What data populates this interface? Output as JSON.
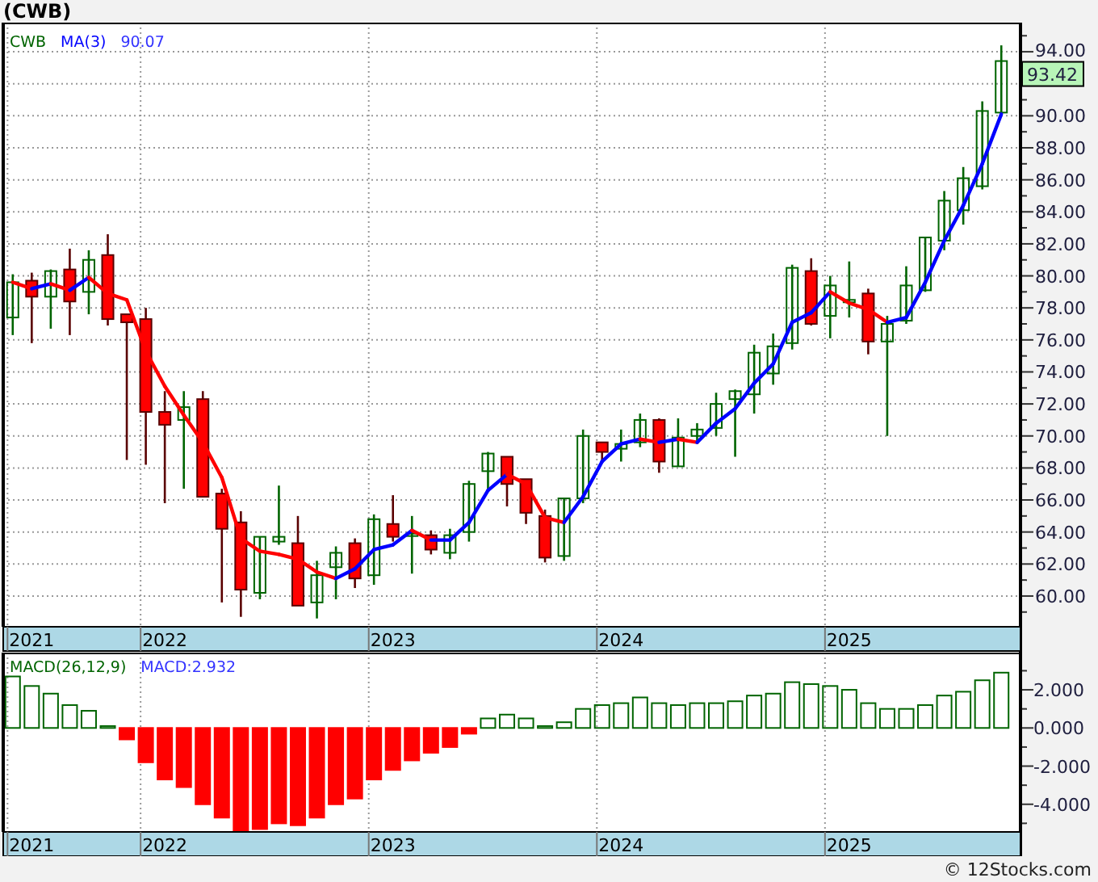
{
  "title": "(CWB)",
  "price_chart": {
    "legend": [
      {
        "text": "90.07",
        "color": "#3333ff"
      }
    ],
    "last_price": "93.42",
    "chart_data": {
      "type": "candlestick",
      "grid": true,
      "ylim": [
        58.08,
        95.82
      ],
      "categories": [
        null,
        "2021",
        null,
        null,
        null,
        null,
        null,
        null,
        "2022",
        null,
        null,
        null,
        null,
        null,
        null,
        null,
        null,
        null,
        null,
        null,
        "2023",
        null,
        null,
        null,
        null,
        null,
        null,
        null,
        null,
        null,
        null,
        null,
        "2024",
        null,
        null,
        null,
        null,
        null,
        null,
        null,
        null,
        null,
        null,
        null,
        "2025",
        null,
        null,
        null,
        null,
        null,
        null,
        null,
        null
      ],
      "yticks": [
        {
          "value": 60,
          "label": "60.00"
        },
        {
          "value": 62,
          "label": "62.00"
        },
        {
          "value": 64,
          "label": "64.00"
        },
        {
          "value": 66,
          "label": "66.00"
        },
        {
          "value": 68,
          "label": "68.00"
        },
        {
          "value": 70,
          "label": "70.00"
        },
        {
          "value": 72,
          "label": "72.00"
        },
        {
          "value": 74,
          "label": "74.00"
        },
        {
          "value": 76,
          "label": "76.00"
        },
        {
          "value": 78,
          "label": "78.00"
        },
        {
          "value": 80,
          "label": "80.00"
        },
        {
          "value": 82,
          "label": "82.00"
        },
        {
          "value": 84,
          "label": "84.00"
        },
        {
          "value": 86,
          "label": "86.00"
        },
        {
          "value": 88,
          "label": "88.00"
        },
        {
          "value": 90,
          "label": "90.00"
        },
        {
          "value": 94,
          "label": "94.00"
        }
      ],
      "series": [
        {
          "name": "CWB",
          "color": "#006400",
          "ohlc": [
            [
              77.4,
              80.1,
              76.3,
              79.6
            ],
            null,
            [
              78.7,
              80.4,
              76.7,
              80.3
            ],
            null,
            [
              79.0,
              81.6,
              77.6,
              81.0
            ],
            null,
            null,
            null,
            null,
            [
              71.0,
              72.8,
              66.7,
              71.8
            ],
            null,
            null,
            null,
            [
              60.2,
              63.7,
              59.8,
              63.7
            ],
            [
              63.4,
              66.9,
              63.2,
              63.7
            ],
            null,
            [
              59.6,
              62.2,
              58.6,
              61.3
            ],
            [
              61.8,
              63.1,
              59.8,
              62.7
            ],
            null,
            [
              61.3,
              65.1,
              60.7,
              64.8
            ],
            null,
            [
              63.8,
              65.0,
              61.4,
              63.9
            ],
            null,
            [
              62.7,
              64.2,
              62.3,
              63.8
            ],
            [
              64.0,
              67.2,
              63.4,
              67.0
            ],
            [
              67.8,
              69.0,
              66.7,
              68.9
            ],
            null,
            null,
            null,
            [
              62.5,
              66.1,
              62.2,
              66.1
            ],
            [
              66.1,
              70.4,
              65.8,
              70.0
            ],
            null,
            [
              69.2,
              70.4,
              68.4,
              69.5
            ],
            [
              69.6,
              71.4,
              69.3,
              71.0
            ],
            null,
            [
              68.1,
              71.1,
              68.1,
              69.9
            ],
            [
              70.0,
              70.8,
              69.6,
              70.4
            ],
            [
              70.5,
              72.7,
              70.0,
              72.0
            ],
            [
              72.3,
              72.9,
              68.7,
              72.8
            ],
            [
              72.6,
              75.7,
              71.4,
              75.2
            ],
            [
              73.9,
              76.4,
              73.2,
              75.6
            ],
            [
              75.8,
              80.7,
              75.4,
              80.5
            ],
            null,
            [
              77.5,
              80.0,
              76.1,
              79.4
            ],
            [
              78.4,
              80.9,
              77.4,
              78.5
            ],
            null,
            [
              75.9,
              77.5,
              70.0,
              77.0
            ],
            [
              77.2,
              80.6,
              77.0,
              79.4
            ],
            [
              79.1,
              82.4,
              79.0,
              82.4
            ],
            [
              82.2,
              85.3,
              81.6,
              84.7
            ],
            [
              84.1,
              86.8,
              83.2,
              86.1
            ],
            [
              85.6,
              90.9,
              85.4,
              90.3
            ],
            [
              90.2,
              94.4,
              90.2,
              93.42
            ]
          ]
        },
        {
          "color": "#ff0000",
          "ohlc": [
            null,
            [
              79.7,
              80.2,
              75.8,
              78.7
            ],
            null,
            [
              80.4,
              81.7,
              76.3,
              78.4
            ],
            null,
            [
              81.3,
              82.6,
              76.9,
              77.3
            ],
            [
              77.6,
              77.6,
              68.5,
              77.1
            ],
            [
              77.3,
              78.0,
              68.2,
              71.5
            ],
            [
              71.5,
              72.8,
              65.8,
              70.7
            ],
            null,
            [
              72.3,
              72.8,
              66.2,
              66.2
            ],
            [
              66.4,
              66.7,
              59.6,
              64.2
            ],
            [
              64.6,
              65.3,
              58.7,
              60.4
            ],
            null,
            null,
            [
              63.3,
              65.0,
              59.4,
              59.4
            ],
            null,
            null,
            [
              63.3,
              63.6,
              60.5,
              61.1
            ],
            null,
            [
              64.5,
              66.3,
              63.4,
              63.7
            ],
            null,
            [
              63.8,
              64.1,
              62.6,
              62.9
            ],
            null,
            null,
            null,
            [
              68.7,
              68.7,
              65.6,
              67.0
            ],
            [
              67.3,
              67.3,
              64.5,
              65.2
            ],
            [
              65.0,
              65.4,
              62.1,
              62.4
            ],
            null,
            null,
            [
              69.6,
              69.6,
              68.4,
              69.0
            ],
            null,
            null,
            [
              71.0,
              71.1,
              67.7,
              68.4
            ],
            null,
            null,
            null,
            null,
            null,
            null,
            null,
            [
              80.3,
              81.1,
              76.9,
              77.0
            ],
            null,
            null,
            [
              78.9,
              79.2,
              75.1,
              75.9
            ],
            null,
            null,
            null,
            null,
            null,
            null,
            null
          ]
        },
        {
          "type": "line",
          "color": "#ff0000",
          "values": [
            79.6,
            79.2,
            null,
            null,
            null,
            null,
            null,
            null,
            null,
            null,
            null,
            null,
            null,
            null,
            null,
            null,
            null,
            null,
            null,
            null,
            null,
            null,
            null,
            null,
            null,
            null,
            null,
            null,
            null,
            null,
            null,
            null,
            null,
            null,
            null,
            null,
            null,
            null,
            null,
            null,
            null,
            null,
            null,
            null,
            null,
            null,
            null,
            null,
            null,
            null,
            null,
            null,
            null
          ]
        },
        {
          "name": "MA(3)",
          "type": "line",
          "color": "#0000ff",
          "values": [
            null,
            79.2,
            79.5,
            null,
            null,
            null,
            null,
            null,
            null,
            null,
            null,
            null,
            null,
            null,
            null,
            null,
            null,
            null,
            null,
            null,
            null,
            null,
            null,
            null,
            null,
            null,
            null,
            null,
            null,
            null,
            null,
            null,
            null,
            null,
            null,
            null,
            null,
            null,
            null,
            null,
            null,
            null,
            null,
            null,
            null,
            null,
            null,
            null,
            null,
            null,
            null,
            null,
            null
          ]
        },
        {
          "type": "line",
          "color": "#ff0000",
          "values": [
            null,
            null,
            79.5,
            79.1,
            null,
            null,
            null,
            null,
            null,
            null,
            null,
            null,
            null,
            null,
            null,
            null,
            null,
            null,
            null,
            null,
            null,
            null,
            null,
            null,
            null,
            null,
            null,
            null,
            null,
            null,
            null,
            null,
            null,
            null,
            null,
            null,
            null,
            null,
            null,
            null,
            null,
            null,
            null,
            null,
            null,
            null,
            null,
            null,
            null,
            null,
            null,
            null,
            null
          ]
        },
        {
          "type": "line",
          "color": "#0000ff",
          "values": [
            null,
            null,
            null,
            79.1,
            79.9,
            null,
            null,
            null,
            null,
            null,
            null,
            null,
            null,
            null,
            null,
            null,
            null,
            null,
            null,
            null,
            null,
            null,
            null,
            null,
            null,
            null,
            null,
            null,
            null,
            null,
            null,
            null,
            null,
            null,
            null,
            null,
            null,
            null,
            null,
            null,
            null,
            null,
            null,
            null,
            null,
            null,
            null,
            null,
            null,
            null,
            null,
            null,
            null
          ]
        },
        {
          "type": "line",
          "color": "#ff0000",
          "values": [
            null,
            null,
            null,
            null,
            79.9,
            78.9,
            78.5,
            75.3,
            73.1,
            71.3,
            69.6,
            67.4,
            63.6,
            62.8,
            62.6,
            62.3,
            61.5,
            61.1,
            null,
            null,
            null,
            null,
            null,
            null,
            null,
            null,
            null,
            null,
            null,
            null,
            null,
            null,
            null,
            null,
            null,
            null,
            null,
            null,
            null,
            null,
            null,
            null,
            null,
            null,
            null,
            null,
            null,
            null,
            null,
            null,
            null,
            null,
            null
          ]
        },
        {
          "type": "line",
          "color": "#0000ff",
          "values": [
            null,
            null,
            null,
            null,
            null,
            null,
            null,
            null,
            null,
            null,
            null,
            null,
            null,
            null,
            null,
            null,
            null,
            61.1,
            61.7,
            62.9,
            63.2,
            64.1,
            null,
            null,
            null,
            null,
            null,
            null,
            null,
            null,
            null,
            null,
            null,
            null,
            null,
            null,
            null,
            null,
            null,
            null,
            null,
            null,
            null,
            null,
            null,
            null,
            null,
            null,
            null,
            null,
            null,
            null,
            null
          ]
        },
        {
          "type": "line",
          "color": "#ff0000",
          "values": [
            null,
            null,
            null,
            null,
            null,
            null,
            null,
            null,
            null,
            null,
            null,
            null,
            null,
            null,
            null,
            null,
            null,
            null,
            null,
            null,
            null,
            64.1,
            63.5,
            null,
            null,
            null,
            null,
            null,
            null,
            null,
            null,
            null,
            null,
            null,
            null,
            null,
            null,
            null,
            null,
            null,
            null,
            null,
            null,
            null,
            null,
            null,
            null,
            null,
            null,
            null,
            null,
            null,
            null
          ]
        },
        {
          "type": "line",
          "color": "#0000ff",
          "values": [
            null,
            null,
            null,
            null,
            null,
            null,
            null,
            null,
            null,
            null,
            null,
            null,
            null,
            null,
            null,
            null,
            null,
            null,
            null,
            null,
            null,
            null,
            63.5,
            63.5,
            64.6,
            66.6,
            67.6,
            null,
            null,
            null,
            null,
            null,
            null,
            null,
            null,
            null,
            null,
            null,
            null,
            null,
            null,
            null,
            null,
            null,
            null,
            null,
            null,
            null,
            null,
            null,
            null,
            null,
            null
          ]
        },
        {
          "type": "line",
          "color": "#ff0000",
          "values": [
            null,
            null,
            null,
            null,
            null,
            null,
            null,
            null,
            null,
            null,
            null,
            null,
            null,
            null,
            null,
            null,
            null,
            null,
            null,
            null,
            null,
            null,
            null,
            null,
            null,
            null,
            67.6,
            67.0,
            64.9,
            64.6,
            null,
            null,
            null,
            null,
            null,
            null,
            null,
            null,
            null,
            null,
            null,
            null,
            null,
            null,
            null,
            null,
            null,
            null,
            null,
            null,
            null,
            null,
            null
          ]
        },
        {
          "type": "line",
          "color": "#0000ff",
          "values": [
            null,
            null,
            null,
            null,
            null,
            null,
            null,
            null,
            null,
            null,
            null,
            null,
            null,
            null,
            null,
            null,
            null,
            null,
            null,
            null,
            null,
            null,
            null,
            null,
            null,
            null,
            null,
            null,
            null,
            64.6,
            66.2,
            68.4,
            69.5,
            69.8,
            null,
            null,
            null,
            null,
            null,
            null,
            null,
            null,
            null,
            null,
            null,
            null,
            null,
            null,
            null,
            null,
            null,
            null,
            null
          ]
        },
        {
          "type": "line",
          "color": "#ff0000",
          "values": [
            null,
            null,
            null,
            null,
            null,
            null,
            null,
            null,
            null,
            null,
            null,
            null,
            null,
            null,
            null,
            null,
            null,
            null,
            null,
            null,
            null,
            null,
            null,
            null,
            null,
            null,
            null,
            null,
            null,
            null,
            null,
            null,
            null,
            69.8,
            69.6,
            null,
            null,
            null,
            null,
            null,
            null,
            null,
            null,
            null,
            null,
            null,
            null,
            null,
            null,
            null,
            null,
            null,
            null
          ]
        },
        {
          "type": "line",
          "color": "#0000ff",
          "values": [
            null,
            null,
            null,
            null,
            null,
            null,
            null,
            null,
            null,
            null,
            null,
            null,
            null,
            null,
            null,
            null,
            null,
            null,
            null,
            null,
            null,
            null,
            null,
            null,
            null,
            null,
            null,
            null,
            null,
            null,
            null,
            null,
            null,
            null,
            69.6,
            69.8,
            null,
            null,
            null,
            null,
            null,
            null,
            null,
            null,
            null,
            null,
            null,
            null,
            null,
            null,
            null,
            null,
            null
          ]
        },
        {
          "type": "line",
          "color": "#ff0000",
          "values": [
            null,
            null,
            null,
            null,
            null,
            null,
            null,
            null,
            null,
            null,
            null,
            null,
            null,
            null,
            null,
            null,
            null,
            null,
            null,
            null,
            null,
            null,
            null,
            null,
            null,
            null,
            null,
            null,
            null,
            null,
            null,
            null,
            null,
            null,
            null,
            69.8,
            69.6,
            null,
            null,
            null,
            null,
            null,
            null,
            null,
            null,
            null,
            null,
            null,
            null,
            null,
            null,
            null,
            null
          ]
        },
        {
          "type": "line",
          "color": "#0000ff",
          "values": [
            null,
            null,
            null,
            null,
            null,
            null,
            null,
            null,
            null,
            null,
            null,
            null,
            null,
            null,
            null,
            null,
            null,
            null,
            null,
            null,
            null,
            null,
            null,
            null,
            null,
            null,
            null,
            null,
            null,
            null,
            null,
            null,
            null,
            null,
            null,
            null,
            69.6,
            70.8,
            71.7,
            73.3,
            74.5,
            77.1,
            77.7,
            79.0,
            null,
            null,
            null,
            null,
            null,
            null,
            null,
            null,
            null
          ]
        },
        {
          "type": "line",
          "color": "#ff0000",
          "values": [
            null,
            null,
            null,
            null,
            null,
            null,
            null,
            null,
            null,
            null,
            null,
            null,
            null,
            null,
            null,
            null,
            null,
            null,
            null,
            null,
            null,
            null,
            null,
            null,
            null,
            null,
            null,
            null,
            null,
            null,
            null,
            null,
            null,
            null,
            null,
            null,
            null,
            null,
            null,
            null,
            null,
            null,
            null,
            79.0,
            78.3,
            77.9,
            77.1,
            null,
            null,
            null,
            null,
            null,
            null
          ]
        },
        {
          "type": "line",
          "color": "#0000ff",
          "values": [
            null,
            null,
            null,
            null,
            null,
            null,
            null,
            null,
            null,
            null,
            null,
            null,
            null,
            null,
            null,
            null,
            null,
            null,
            null,
            null,
            null,
            null,
            null,
            null,
            null,
            null,
            null,
            null,
            null,
            null,
            null,
            null,
            null,
            null,
            null,
            null,
            null,
            null,
            null,
            null,
            null,
            null,
            null,
            null,
            null,
            null,
            77.1,
            77.4,
            79.6,
            82.2,
            84.4,
            87.0,
            90.1
          ]
        }
      ]
    }
  },
  "macd_chart": {
    "legend": [
      {
        "text": "MACD:2.932",
        "color": "#3333ff"
      }
    ],
    "chart_data": {
      "type": "bar",
      "ylim": [
        -5.45,
        3.95
      ],
      "categories": [
        null,
        "2021",
        null,
        null,
        null,
        null,
        null,
        null,
        "2022",
        null,
        null,
        null,
        null,
        null,
        null,
        null,
        null,
        null,
        null,
        null,
        "2023",
        null,
        null,
        null,
        null,
        null,
        null,
        null,
        null,
        null,
        null,
        null,
        "2024",
        null,
        null,
        null,
        null,
        null,
        null,
        null,
        null,
        null,
        null,
        null,
        "2025",
        null,
        null,
        null,
        null,
        null,
        null,
        null,
        null
      ],
      "yticks": [
        {
          "value": 2,
          "label": "2.000"
        },
        {
          "value": 0,
          "label": "0.000"
        },
        {
          "value": -2,
          "label": "-2.000"
        },
        {
          "value": -4,
          "label": "-4.000"
        }
      ],
      "series": [
        {
          "name": "MACD(26,12,9)",
          "color": "#006400",
          "values": [
            2.7,
            2.2,
            1.8,
            1.2,
            0.9,
            0.1,
            null,
            null,
            null,
            null,
            null,
            null,
            null,
            null,
            null,
            null,
            null,
            null,
            null,
            null,
            null,
            null,
            null,
            null,
            null,
            0.5,
            0.7,
            0.5,
            0.1,
            0.3,
            1.0,
            1.2,
            1.3,
            1.6,
            1.3,
            1.2,
            1.3,
            1.3,
            1.4,
            1.7,
            1.8,
            2.4,
            2.3,
            2.2,
            2.0,
            1.3,
            1.0,
            1.0,
            1.2,
            1.7,
            1.9,
            2.5,
            2.9
          ]
        },
        {
          "color": "#ff0000",
          "values": [
            null,
            null,
            null,
            null,
            null,
            null,
            -0.6,
            -1.8,
            -2.7,
            -3.1,
            -4.0,
            -4.7,
            -5.4,
            -5.3,
            -5.0,
            -5.1,
            -4.7,
            -4.0,
            -3.7,
            -2.7,
            -2.2,
            -1.7,
            -1.3,
            -1.0,
            -0.3,
            null,
            null,
            null,
            null,
            null,
            null,
            null,
            null,
            null,
            null,
            null,
            null,
            null,
            null,
            null,
            null,
            null,
            null,
            null,
            null,
            null,
            null,
            null,
            null,
            null,
            null,
            null,
            null
          ]
        }
      ]
    }
  },
  "footer": "© 12Stocks.com"
}
